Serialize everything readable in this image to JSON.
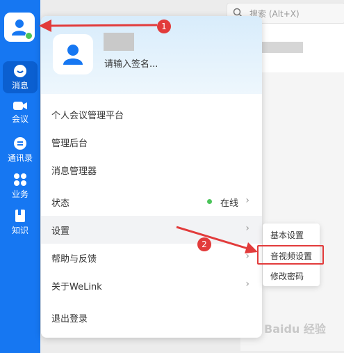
{
  "search": {
    "placeholder": "搜索 (Alt+X)"
  },
  "rail": {
    "items": [
      {
        "label": "消息"
      },
      {
        "label": "会议"
      },
      {
        "label": "通讯录"
      },
      {
        "label": "业务"
      },
      {
        "label": "知识"
      }
    ]
  },
  "profile": {
    "signature": "请输入签名..."
  },
  "menu": {
    "items": [
      {
        "label": "个人会议管理平台"
      },
      {
        "label": "管理后台"
      },
      {
        "label": "消息管理器"
      },
      {
        "label": "状态"
      },
      {
        "label": "设置"
      },
      {
        "label": "帮助与反馈"
      },
      {
        "label": "关于WeLink"
      },
      {
        "label": "退出登录"
      }
    ],
    "status_value": "在线",
    "chevron": "›"
  },
  "submenu": {
    "items": [
      {
        "label": "基本设置"
      },
      {
        "label": "音视频设置"
      },
      {
        "label": "修改密码"
      }
    ]
  },
  "annotations": {
    "badge1": "1",
    "badge2": "2"
  },
  "watermark": "Baidu 经验",
  "colors": {
    "rail": "#1677f2",
    "accent_red": "#e23b3b",
    "online": "#4bc45a"
  }
}
